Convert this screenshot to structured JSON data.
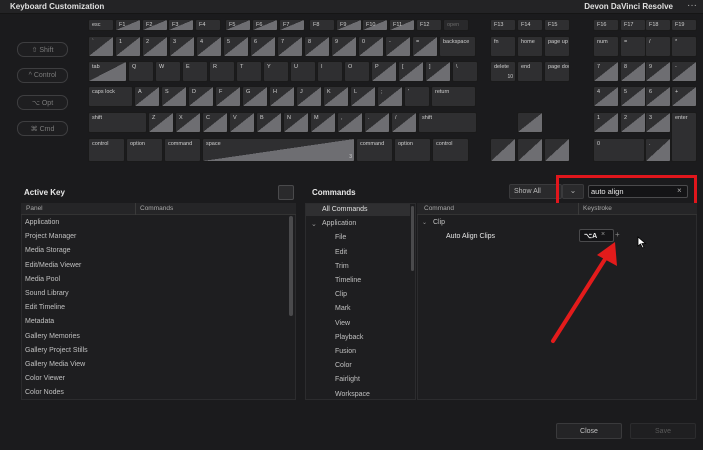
{
  "window": {
    "title": "Keyboard Customization",
    "preset": "Devon DaVinci Resolve",
    "more": "···"
  },
  "modifiers": [
    "⇧ Shift",
    "^ Control",
    "⌥ Opt",
    "⌘ Cmd"
  ],
  "keyboard": {
    "fn_row": [
      "esc",
      "F1",
      "F2",
      "F3",
      "F4",
      "F5",
      "F6",
      "F7",
      "F8",
      "F9",
      "F10",
      "F11",
      "F12",
      "open"
    ],
    "nav_fn": [
      "F13",
      "F14",
      "F15"
    ],
    "num_fn": [
      "F16",
      "F17",
      "F18",
      "F19"
    ],
    "row1": [
      "`",
      "1",
      "2",
      "3",
      "4",
      "5",
      "6",
      "7",
      "8",
      "9",
      "0",
      "-",
      "=",
      "backspace"
    ],
    "row2": [
      "tab",
      "Q",
      "W",
      "E",
      "R",
      "T",
      "Y",
      "U",
      "I",
      "O",
      "P",
      "[",
      "]",
      "\\"
    ],
    "row3": [
      "caps lock",
      "A",
      "S",
      "D",
      "F",
      "G",
      "H",
      "J",
      "K",
      "L",
      ";",
      "'",
      "return"
    ],
    "row4": [
      "shift",
      "Z",
      "X",
      "C",
      "V",
      "B",
      "N",
      "M",
      ",",
      ".",
      "/",
      "shift"
    ],
    "row5": [
      "control",
      "option",
      "command",
      "space",
      "command",
      "option",
      "control"
    ],
    "space_sub": "3",
    "nav1": [
      "fn",
      "home",
      "page up"
    ],
    "nav2": [
      "delete",
      "end",
      "page down"
    ],
    "nav2_sub": "10",
    "num": [
      [
        "num",
        "=",
        "/",
        "*"
      ],
      [
        "7",
        "8",
        "9",
        "-"
      ],
      [
        "4",
        "5",
        "6",
        "+"
      ],
      [
        "1",
        "2",
        "3",
        "enter"
      ],
      [
        "0",
        "."
      ]
    ]
  },
  "active_key": {
    "title": "Active Key",
    "col_panel": "Panel",
    "col_commands": "Commands",
    "items": [
      "Application",
      "Project Manager",
      "Media Storage",
      "Edit/Media Viewer",
      "Media Pool",
      "Sound Library",
      "Edit Timeline",
      "Metadata",
      "Gallery Memories",
      "Gallery Project Stills",
      "Gallery Media View",
      "Color Viewer",
      "Color Nodes"
    ]
  },
  "commands": {
    "title": "Commands",
    "show_all": "Show All",
    "search_value": "auto align",
    "clear": "×",
    "tree": [
      "All Commands",
      "Application",
      "File",
      "Edit",
      "Trim",
      "Timeline",
      "Clip",
      "Mark",
      "View",
      "Playback",
      "Fusion",
      "Color",
      "Fairlight",
      "Workspace"
    ],
    "col_command": "Command",
    "col_keystroke": "Keystroke",
    "group": "Clip",
    "result": "Auto Align Clips",
    "keystroke": "⌥A",
    "remove": "×",
    "add": "+"
  },
  "footer": {
    "close": "Close",
    "save": "Save"
  },
  "colors": {
    "highlight": "#e0161c",
    "arrow": "#e31b1b"
  }
}
